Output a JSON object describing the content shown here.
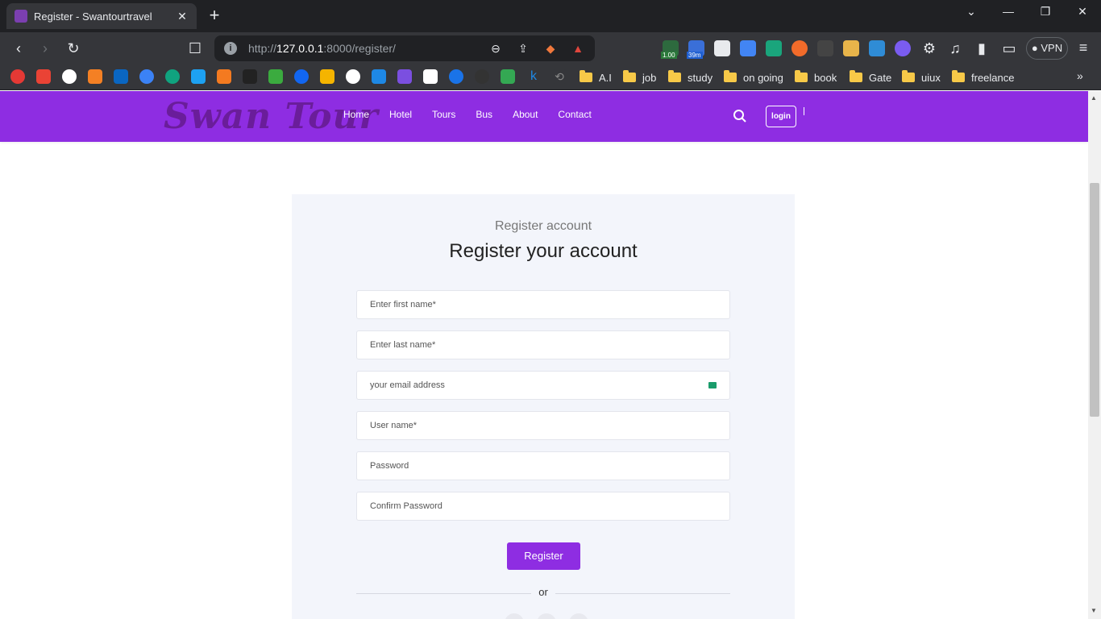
{
  "browser": {
    "tab_title": "Register - Swantourtravel",
    "url_prefix": "http://",
    "url_host": "127.0.0.1",
    "url_rest": ":8000/register/",
    "new_tab": "+",
    "vpn_label": "VPN",
    "ext_badge_1": "1.00",
    "ext_badge_2": "39m"
  },
  "bookmarks": {
    "folders": [
      "A.I",
      "job",
      "study",
      "on going",
      "book",
      "Gate",
      "uiux",
      "freelance"
    ],
    "more": "»"
  },
  "site": {
    "logo": "Swan Tour",
    "nav": [
      "Home",
      "Hotel",
      "Tours",
      "Bus",
      "About",
      "Contact"
    ],
    "login": "login",
    "brand_color": "#8e2de2"
  },
  "form": {
    "subtitle": "Register account",
    "heading": "Register your account",
    "first_name_placeholder": "Enter first name*",
    "last_name_placeholder": "Enter last name*",
    "email_placeholder": "your email address",
    "username_placeholder": "User name*",
    "password_placeholder": "Password",
    "confirm_placeholder": "Confirm Password",
    "register_label": "Register",
    "or_label": "or"
  }
}
